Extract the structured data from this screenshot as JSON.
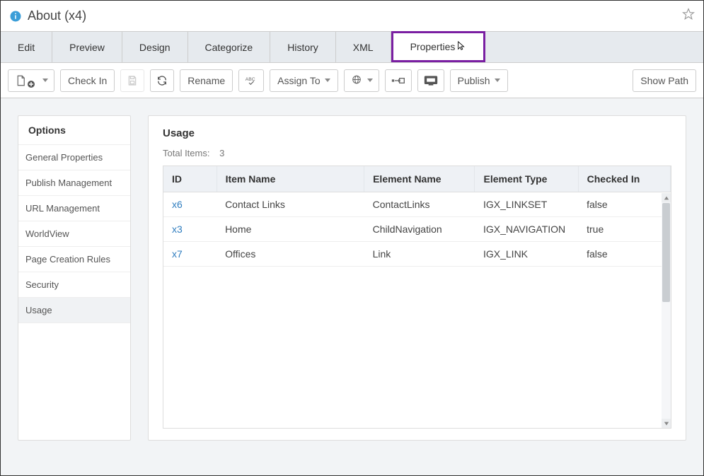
{
  "titlebar": {
    "title": "About",
    "suffix": "(x4)"
  },
  "tabs": [
    "Edit",
    "Preview",
    "Design",
    "Categorize",
    "History",
    "XML",
    "Properties"
  ],
  "active_tab_index": 6,
  "toolbar": {
    "check_in": "Check In",
    "rename": "Rename",
    "assign_to": "Assign To",
    "publish": "Publish",
    "show_path": "Show Path"
  },
  "sidebar": {
    "header": "Options",
    "items": [
      "General Properties",
      "Publish Management",
      "URL Management",
      "WorldView",
      "Page Creation Rules",
      "Security",
      "Usage"
    ],
    "selected_index": 6
  },
  "main": {
    "heading": "Usage",
    "total_label": "Total Items:",
    "total_value": "3",
    "columns": [
      "ID",
      "Item Name",
      "Element Name",
      "Element Type",
      "Checked In"
    ],
    "rows": [
      {
        "id": "x6",
        "item_name": "Contact Links",
        "element_name": "ContactLinks",
        "element_type": "IGX_LINKSET",
        "checked_in": "false"
      },
      {
        "id": "x3",
        "item_name": "Home",
        "element_name": "ChildNavigation",
        "element_type": "IGX_NAVIGATION",
        "checked_in": "true"
      },
      {
        "id": "x7",
        "item_name": "Offices",
        "element_name": "Link",
        "element_type": "IGX_LINK",
        "checked_in": "false"
      }
    ]
  }
}
